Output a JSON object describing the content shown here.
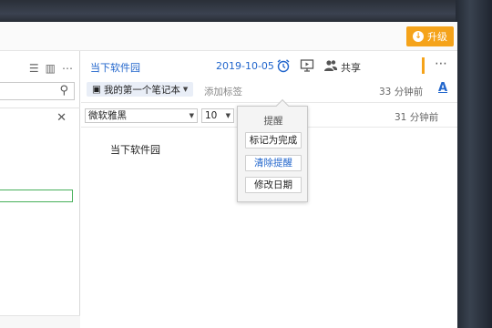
{
  "topbar": {
    "upgrade_label": "升级"
  },
  "note": {
    "title": "当下软件园",
    "date": "2019-10-05",
    "share_label": "共享",
    "notebook": "我的第一个笔记本",
    "tag_placeholder": "添加标签",
    "modified_1": "33 分钟前",
    "modified_2": "31 分钟前",
    "font_family": "微软雅黑",
    "font_size": "10",
    "body": "当下软件园"
  },
  "reminder_popup": {
    "title": "提醒",
    "mark_done": "标记为完成",
    "clear": "清除提醒",
    "change_date": "修改日期"
  },
  "colors": {
    "accent_blue": "#2266cc",
    "upgrade_orange": "#f5a31a",
    "green_outline": "#47b05a"
  }
}
